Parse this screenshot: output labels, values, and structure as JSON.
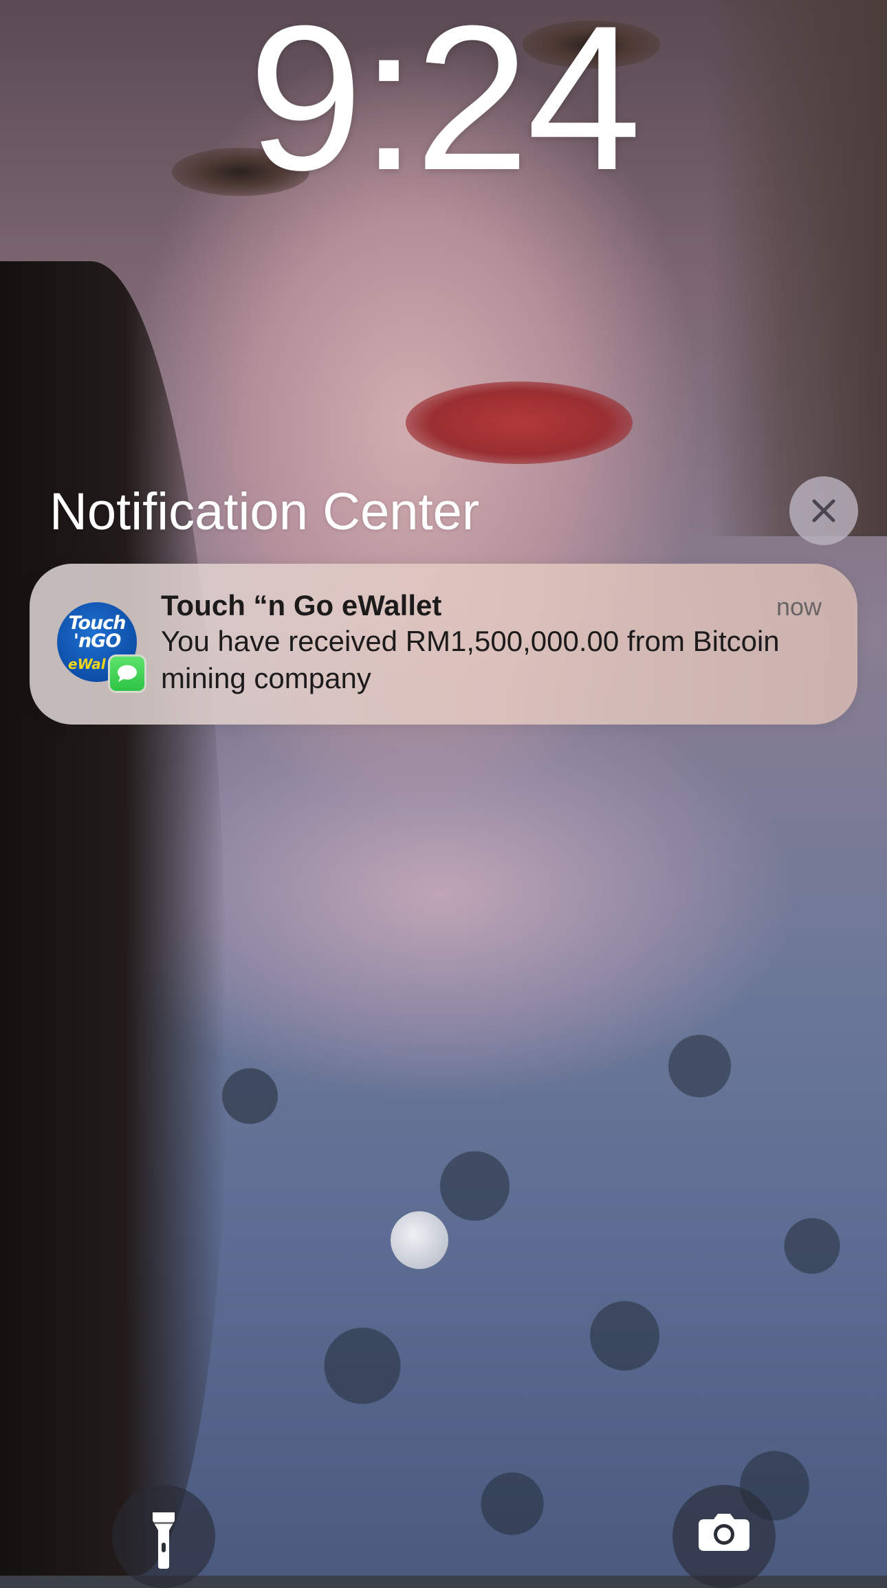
{
  "lock_screen": {
    "time": "9:24"
  },
  "notification_center": {
    "title": "Notification Center",
    "clear_icon": "close-icon"
  },
  "notification": {
    "app_name": "Touch “n Go eWallet",
    "time": "now",
    "message": "You have received RM1,500,000.00 from Bitcoin mining company",
    "app_icon": "touch-n-go-logo",
    "badge_icon": "messages-icon",
    "logo_text_top": "Touch 'nGO",
    "logo_text_bottom": "eWal"
  },
  "quick_actions": {
    "left_icon": "flashlight-icon",
    "right_icon": "camera-icon"
  },
  "colors": {
    "badge_green": "#34c759",
    "logo_blue": "#0d4fa8",
    "logo_yellow": "#f3d51a"
  }
}
